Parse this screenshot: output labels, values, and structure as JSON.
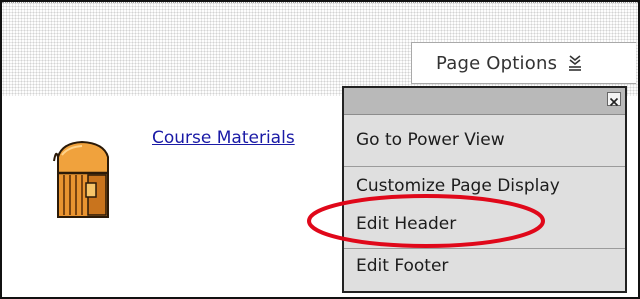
{
  "header": {
    "page_options_label": "Page Options",
    "page_options_icon": "double-chevron-down-icon"
  },
  "content": {
    "course_link_label": "Course Materials",
    "folder_icon": "treasure-chest-icon"
  },
  "page_options_menu": {
    "close_icon": "close-icon",
    "items": [
      {
        "label": "Go to Power View"
      },
      {
        "label": "Customize Page Display"
      },
      {
        "label": "Edit Header"
      },
      {
        "label": "Edit Footer"
      }
    ]
  },
  "annotation": {
    "shape": "ellipse",
    "color": "#e0081a",
    "target": "Edit Header"
  }
}
